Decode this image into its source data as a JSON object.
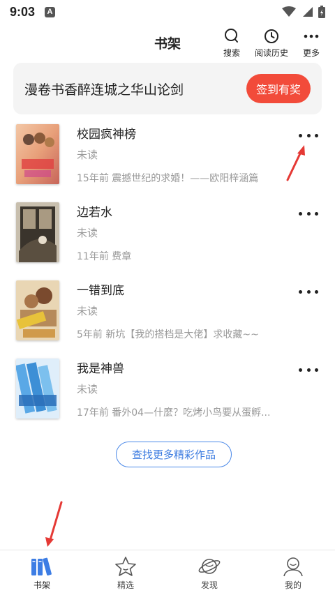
{
  "status_bar": {
    "time": "9:03",
    "badge": "A"
  },
  "header": {
    "title": "书架",
    "actions": [
      {
        "label": "搜索",
        "icon": "search-icon"
      },
      {
        "label": "阅读历史",
        "icon": "clock-icon"
      },
      {
        "label": "更多",
        "icon": "more-dots-icon"
      }
    ]
  },
  "banner": {
    "text": "漫卷书香醉连城之华山论剑",
    "button": "签到有奖"
  },
  "books": [
    {
      "title": "校园疯神榜",
      "status": "未读",
      "latest": "15年前 震撼世纪的求婚！——欧阳梓涵篇"
    },
    {
      "title": "边若水",
      "status": "未读",
      "latest": "11年前 费章"
    },
    {
      "title": "一错到底",
      "status": "未读",
      "latest": "5年前 新坑【我的搭档是大佬】求收藏~~"
    },
    {
      "title": "我是神兽",
      "status": "未读",
      "latest": "17年前 番外04—什麼？吃烤小鸟要从蛋孵..."
    }
  ],
  "more_button": "查找更多精彩作品",
  "bottom_nav": [
    {
      "label": "书架",
      "icon": "bookshelf-icon",
      "active": true
    },
    {
      "label": "精选",
      "icon": "star-icon",
      "active": false
    },
    {
      "label": "发现",
      "icon": "planet-icon",
      "active": false
    },
    {
      "label": "我的",
      "icon": "user-icon",
      "active": false
    }
  ],
  "colors": {
    "accent": "#f24b3a",
    "link": "#3b7be0",
    "tab_active": "#3d7de4"
  }
}
